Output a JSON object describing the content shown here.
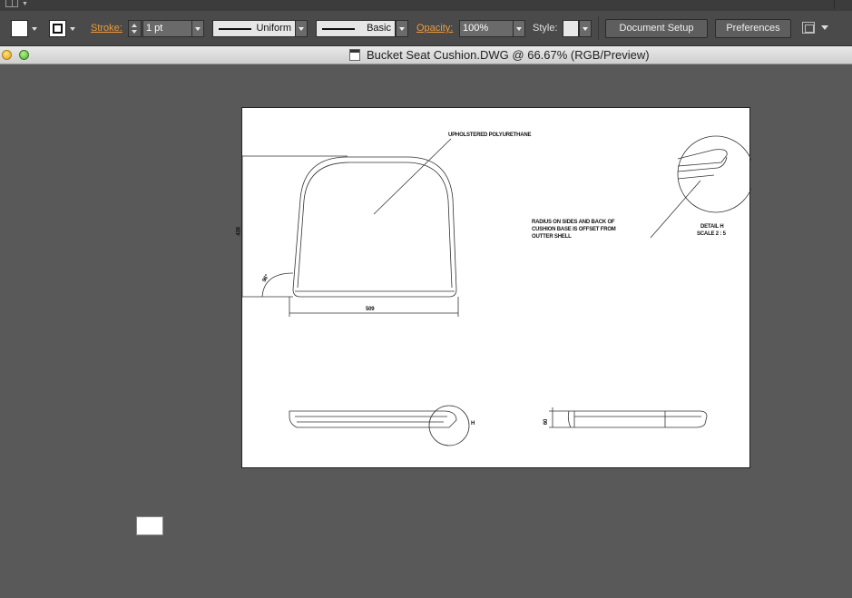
{
  "control_bar": {
    "stroke_label": "Stroke:",
    "stroke_weight": "1 pt",
    "profile": "Uniform",
    "brush": "Basic",
    "opacity_label": "Opacity:",
    "opacity_value": "100%",
    "style_label": "Style:",
    "document_setup_label": "Document Setup",
    "preferences_label": "Preferences"
  },
  "document": {
    "title": "Bucket Seat Cushion.DWG @ 66.67% (RGB/Preview)"
  },
  "drawing": {
    "callout_material": "UPHOLSTERED POLYURETHANE",
    "callout_radius_line1": "RADIUS ON SIDES AND BACK OF",
    "callout_radius_line2": "CUSHION BASE IS OFFSET FROM",
    "callout_radius_line3": "OUTTER SHELL",
    "detail_title": "DETAIL H",
    "detail_scale": "SCALE 2 : 5",
    "dim_width": "509",
    "dim_height": "438",
    "dim_angle": "96°",
    "dim_thickness": "60",
    "detail_marker": "H"
  }
}
